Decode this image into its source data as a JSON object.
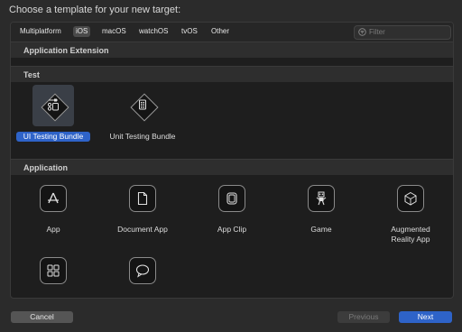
{
  "title": "Choose a template for your new target:",
  "tabs": [
    {
      "label": "Multiplatform"
    },
    {
      "label": "iOS",
      "selected": true
    },
    {
      "label": "macOS"
    },
    {
      "label": "watchOS"
    },
    {
      "label": "tvOS"
    },
    {
      "label": "Other"
    }
  ],
  "filter": {
    "placeholder": "Filter",
    "icon": "filter-icon"
  },
  "sections": {
    "app_extension": "Application Extension",
    "test": "Test",
    "application": "Application"
  },
  "test_items": [
    {
      "label": "UI Testing Bundle",
      "icon": "ui-testing-icon",
      "selected": true
    },
    {
      "label": "Unit Testing Bundle",
      "icon": "unit-testing-icon"
    }
  ],
  "application_items": [
    {
      "label": "App",
      "icon": "app-icon"
    },
    {
      "label": "Document App",
      "icon": "document-icon"
    },
    {
      "label": "App Clip",
      "icon": "app-clip-icon"
    },
    {
      "label": "Game",
      "icon": "game-icon"
    },
    {
      "label": "Augmented Reality App",
      "icon": "ar-cube-icon"
    },
    {
      "label": "",
      "icon": "sticker-grid-icon"
    },
    {
      "label": "",
      "icon": "message-bubble-icon"
    }
  ],
  "buttons": {
    "cancel": "Cancel",
    "previous": "Previous",
    "next": "Next"
  },
  "colors": {
    "accent": "#2e63c8",
    "background": "#2b2b2b",
    "panel": "#1e1e1e"
  }
}
